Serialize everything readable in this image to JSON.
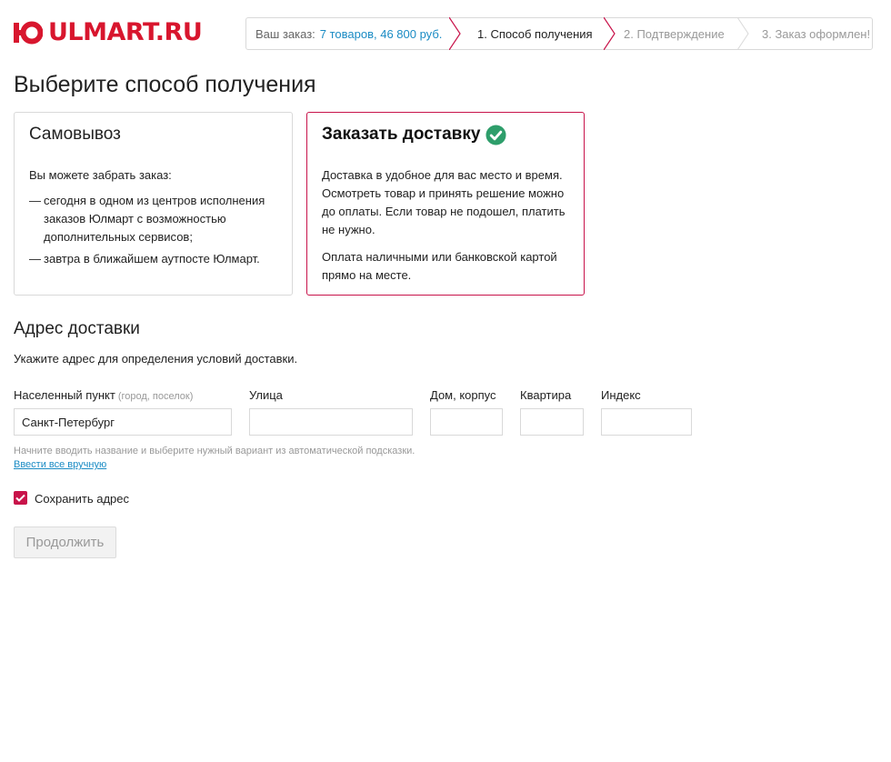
{
  "header": {
    "logo_text": "ULMART.RU",
    "brand_color": "#d8162e",
    "order_summary_label": "Ваш заказ:",
    "order_summary_link": "7 товаров, 46 800 руб.",
    "steps": [
      {
        "label": "1. Способ получения",
        "active": true
      },
      {
        "label": "2. Подтверждение",
        "active": false
      },
      {
        "label": "3. Заказ оформлен!",
        "active": false
      }
    ]
  },
  "page_title": "Выберите способ получения",
  "options": {
    "pickup": {
      "title": "Самовывоз",
      "intro": "Вы можете забрать заказ:",
      "items": [
        "сегодня в одном из центров исполнения заказов Юлмарт с возможностью дополнительных сервисов;",
        "завтра в ближайшем аутпосте Юлмарт."
      ]
    },
    "delivery": {
      "title": "Заказать доставку",
      "selected": true,
      "paragraph1": "Доставка в удобное для вас место и время. Осмотреть товар и принять решение можно до оплаты. Если товар не подошел, платить не нужно.",
      "paragraph2": "Оплата наличными или банковской картой прямо на месте.",
      "selected_color": "#c8134a",
      "check_color": "#2e9e6b"
    }
  },
  "address": {
    "title": "Адрес доставки",
    "description": "Укажите адрес для определения условий доставки.",
    "fields": {
      "city": {
        "label": "Населенный пункт",
        "sublabel": "(город, поселок)",
        "value": "Санкт-Петербург"
      },
      "street": {
        "label": "Улица",
        "value": ""
      },
      "house": {
        "label": "Дом, корпус",
        "value": ""
      },
      "apartment": {
        "label": "Квартира",
        "value": ""
      },
      "zip": {
        "label": "Индекс",
        "value": ""
      }
    },
    "hint": "Начните вводить название и выберите нужный вариант из автоматической подсказки.",
    "manual_link": "Ввести все вручную",
    "save_label": "Сохранить адрес",
    "save_checked": true
  },
  "continue_button": "Продолжить"
}
